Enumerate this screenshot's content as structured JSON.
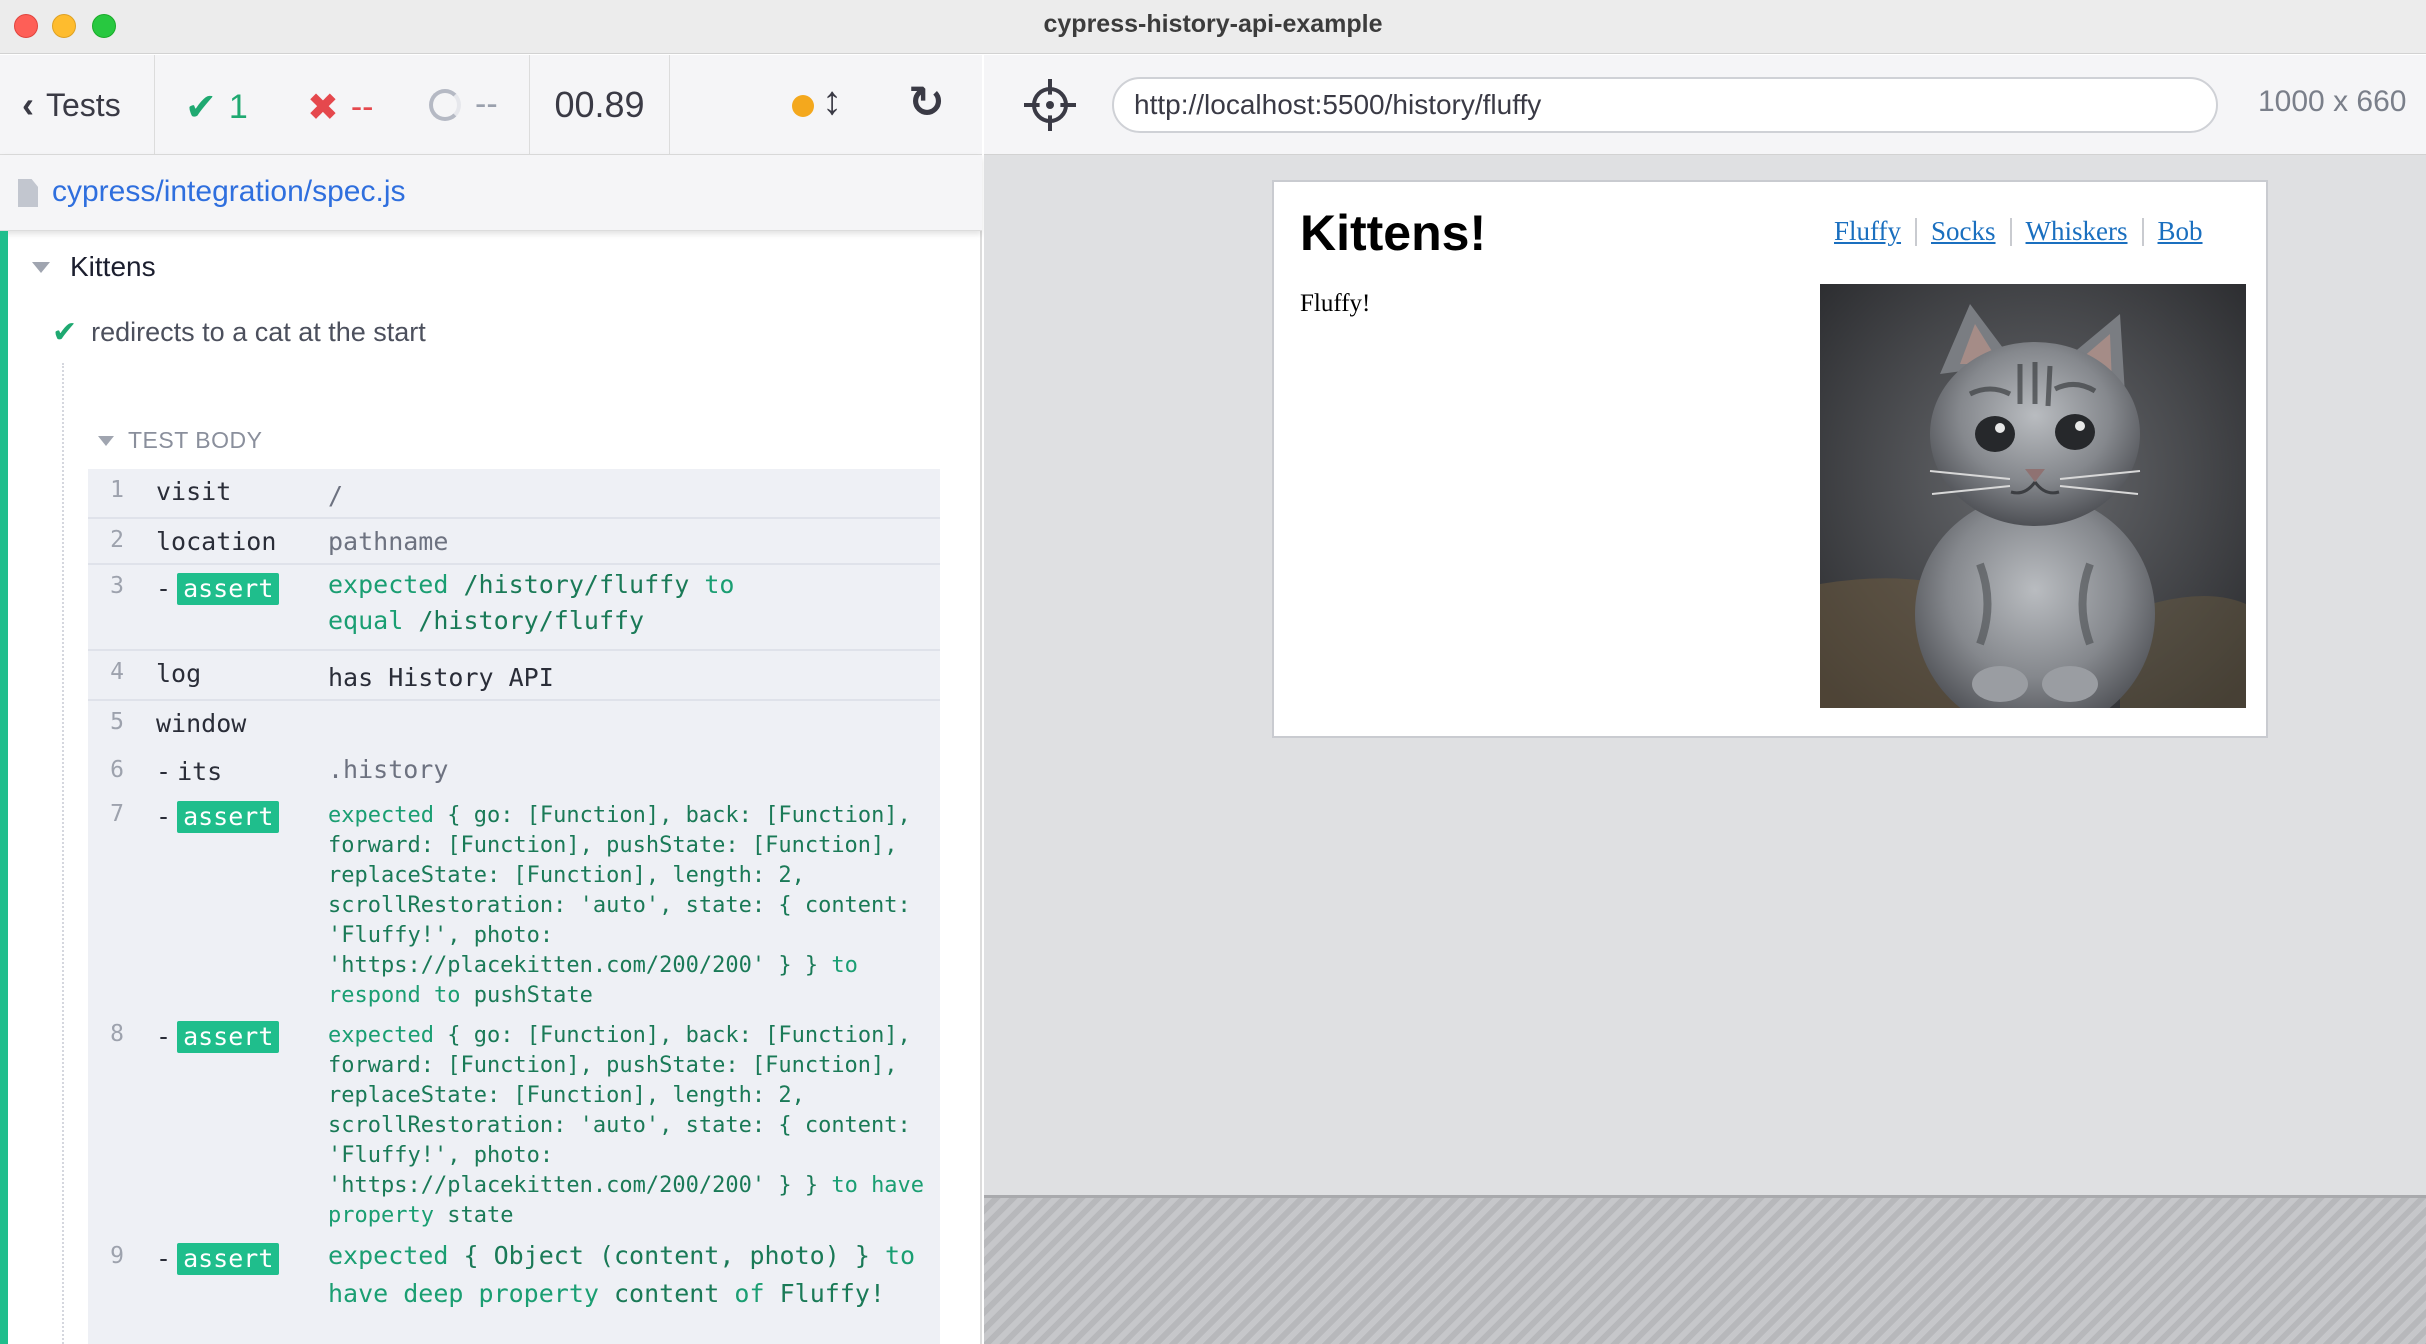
{
  "window": {
    "title": "cypress-history-api-example"
  },
  "reporter": {
    "back_label": "Tests",
    "stats": {
      "passed": "1",
      "failed": "--",
      "pending": "--"
    },
    "duration": "00.89",
    "spec_path": "cypress/integration/spec.js",
    "suite": "Kittens",
    "test": "redirects to a cat at the start",
    "test_body_label": "TEST BODY",
    "commands": [
      {
        "num": "1",
        "name": "visit",
        "message": "/"
      },
      {
        "num": "2",
        "name": "location",
        "message": "pathname"
      },
      {
        "num": "3",
        "name": "assert",
        "parts": [
          "expected",
          "/history/fluffy",
          "to equal",
          "/history/fluffy"
        ]
      },
      {
        "num": "4",
        "name": "log",
        "message": "has History API"
      },
      {
        "num": "5",
        "name": "window",
        "message": ""
      },
      {
        "num": "6",
        "name": "its",
        "message": ".history"
      },
      {
        "num": "7",
        "name": "assert",
        "parts": [
          "expected",
          "{ go: [Function], back: [Function], forward: [Function], pushState: [Function], replaceState: [Function], length: 2, scrollRestoration: 'auto', state: { content: 'Fluffy!', photo: 'https://placekitten.com/200/200' } }",
          "to respond to",
          "pushState"
        ]
      },
      {
        "num": "8",
        "name": "assert",
        "parts": [
          "expected",
          "{ go: [Function], back: [Function], forward: [Function], pushState: [Function], replaceState: [Function], length: 2, scrollRestoration: 'auto', state: { content: 'Fluffy!', photo: 'https://placekitten.com/200/200' } }",
          "to have property",
          "state"
        ]
      },
      {
        "num": "9",
        "name": "assert",
        "parts": [
          "expected",
          "{ Object (content, photo) }",
          "to have deep property",
          "content",
          "of",
          "Fluffy!"
        ]
      }
    ]
  },
  "browser": {
    "url": "http://localhost:5500/history/fluffy",
    "viewport": "1000 x 660",
    "app": {
      "title": "Kittens!",
      "nav": [
        "Fluffy",
        "Socks",
        "Whiskers",
        "Bob"
      ],
      "content": "Fluffy!"
    }
  },
  "colors": {
    "pass": "#1fa971",
    "fail": "#e5484d",
    "accent": "#1fbe8c",
    "link": "#2f6fde",
    "running": "#f4a81d"
  },
  "icons": {
    "back": "chevron-left-icon",
    "pass": "check-icon",
    "fail": "x-icon",
    "pending": "spinner-icon",
    "running": "status-dot-icon",
    "scroll": "arrows-up-down-icon",
    "reload": "reload-icon",
    "file": "file-icon",
    "selector": "crosshair-icon"
  }
}
